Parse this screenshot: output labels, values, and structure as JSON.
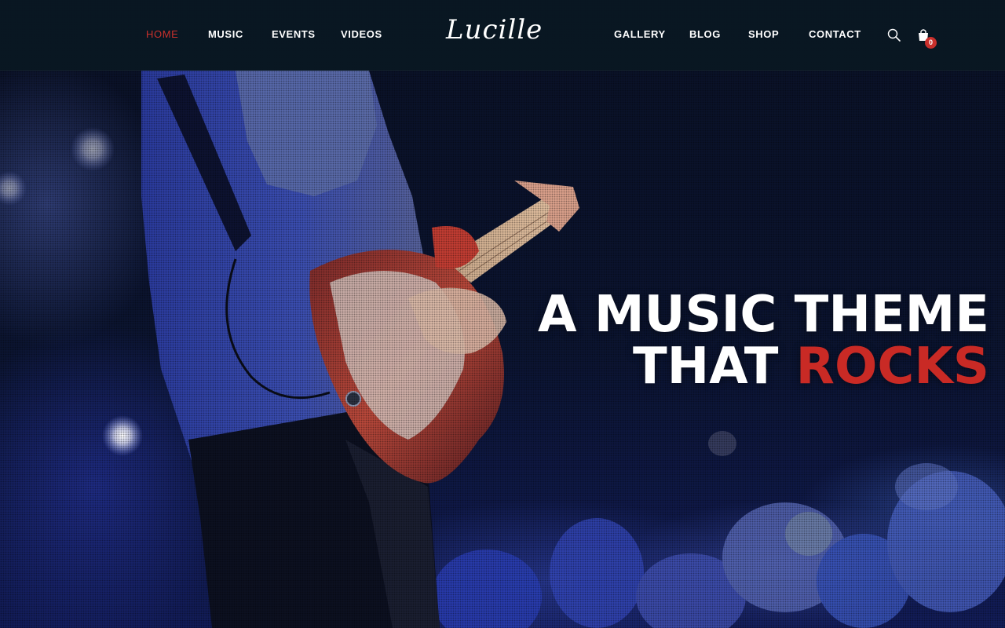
{
  "nav": {
    "left_items": [
      {
        "label": "HOME",
        "active": true
      },
      {
        "label": "MUSIC",
        "active": false
      },
      {
        "label": "EVENTS",
        "active": false
      },
      {
        "label": "VIDEOS",
        "active": false
      }
    ],
    "logo_text": "Lucille",
    "right_items": [
      {
        "label": "GALLERY"
      },
      {
        "label": "BLOG"
      },
      {
        "label": "SHOP"
      },
      {
        "label": "CONTACT"
      }
    ],
    "search_icon": "search-icon",
    "cart_icon": "shopping-bag-icon",
    "cart_count": "0"
  },
  "hero": {
    "headline_line1": "A MUSIC THEME",
    "headline_line2_prefix": "THAT ",
    "headline_line2_accent": "ROCKS",
    "image_subject": "guitarist on stage"
  },
  "colors": {
    "accent": "#c9302c",
    "navbar_bg": "#0a1822",
    "text": "#ffffff"
  }
}
